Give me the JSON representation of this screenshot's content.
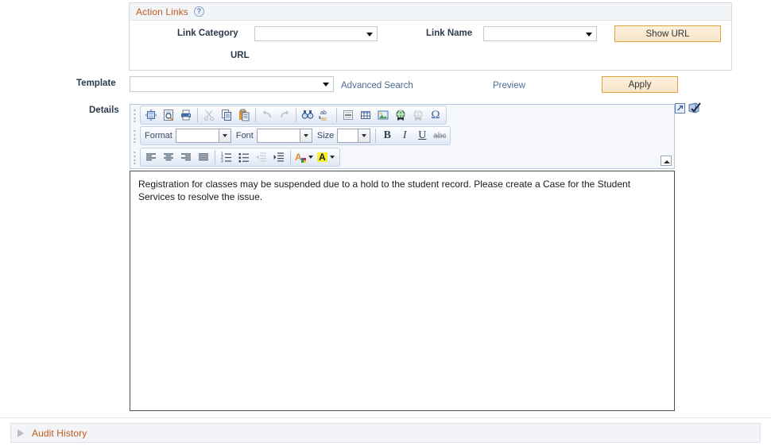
{
  "action_links": {
    "title": "Action Links",
    "help_icon": "help-question-icon",
    "link_category_label": "Link Category",
    "link_category_value": "",
    "link_name_label": "Link Name",
    "link_name_value": "",
    "show_url_label": "Show URL",
    "url_label": "URL"
  },
  "template_row": {
    "label": "Template",
    "value": "",
    "advanced_search_label": "Advanced Search",
    "preview_label": "Preview",
    "apply_label": "Apply"
  },
  "details": {
    "label": "Details",
    "body_text": "Registration for classes may be suspended due to a hold to the student record.  Please create a Case for the Student Services to resolve the issue.",
    "expand_icon": "expand-popup-icon",
    "spellcheck_icon": "spell-check-icon",
    "collapse_toolbar_icon": "collapse-toolbar-icon"
  },
  "editor_toolbar": {
    "row1": [
      {
        "name": "source-template-icon",
        "title": "Templates"
      },
      {
        "name": "preview-document-icon",
        "title": "Preview"
      },
      {
        "name": "print-icon",
        "title": "Print"
      },
      {
        "name": "cut-icon",
        "title": "Cut",
        "disabled": true
      },
      {
        "name": "copy-icon",
        "title": "Copy"
      },
      {
        "name": "paste-icon",
        "title": "Paste"
      },
      {
        "name": "undo-icon",
        "title": "Undo",
        "disabled": true
      },
      {
        "name": "redo-icon",
        "title": "Redo",
        "disabled": true
      },
      {
        "name": "find-icon",
        "title": "Find"
      },
      {
        "name": "replace-icon",
        "title": "Replace"
      },
      {
        "name": "horizontal-rule-icon",
        "title": "Insert Horizontal Line"
      },
      {
        "name": "table-icon",
        "title": "Insert Table"
      },
      {
        "name": "image-icon",
        "title": "Insert Image"
      },
      {
        "name": "link-icon",
        "title": "Insert Link"
      },
      {
        "name": "unlink-icon",
        "title": "Unlink",
        "disabled": true
      },
      {
        "name": "special-character-icon",
        "title": "Insert Special Character"
      }
    ],
    "format_label": "Format",
    "format_value": "",
    "font_label": "Font",
    "font_value": "",
    "size_label": "Size",
    "size_value": "",
    "bold_label": "B",
    "italic_label": "I",
    "underline_label": "U",
    "strikethrough_label": "abc",
    "row3": [
      {
        "name": "align-left-icon",
        "title": "Align Left"
      },
      {
        "name": "align-center-icon",
        "title": "Center"
      },
      {
        "name": "align-right-icon",
        "title": "Align Right"
      },
      {
        "name": "align-justify-icon",
        "title": "Justify"
      },
      {
        "name": "numbered-list-icon",
        "title": "Insert/Remove Numbered List"
      },
      {
        "name": "bulleted-list-icon",
        "title": "Insert/Remove Bulleted List"
      },
      {
        "name": "outdent-icon",
        "title": "Decrease Indent",
        "disabled": true
      },
      {
        "name": "indent-icon",
        "title": "Increase Indent"
      },
      {
        "name": "text-color-icon",
        "title": "Text Color"
      },
      {
        "name": "background-color-icon",
        "title": "Background Color"
      }
    ]
  },
  "audit_history": {
    "label": "Audit History",
    "expanded": false,
    "toggle_icon": "triangle-right-icon"
  },
  "colors": {
    "group_title": "#c05b1e",
    "link": "#4a6a96",
    "button_border": "#d9a441",
    "button_fill": "#f8e3c6",
    "toolbar_bg": "#f5f7fb"
  }
}
